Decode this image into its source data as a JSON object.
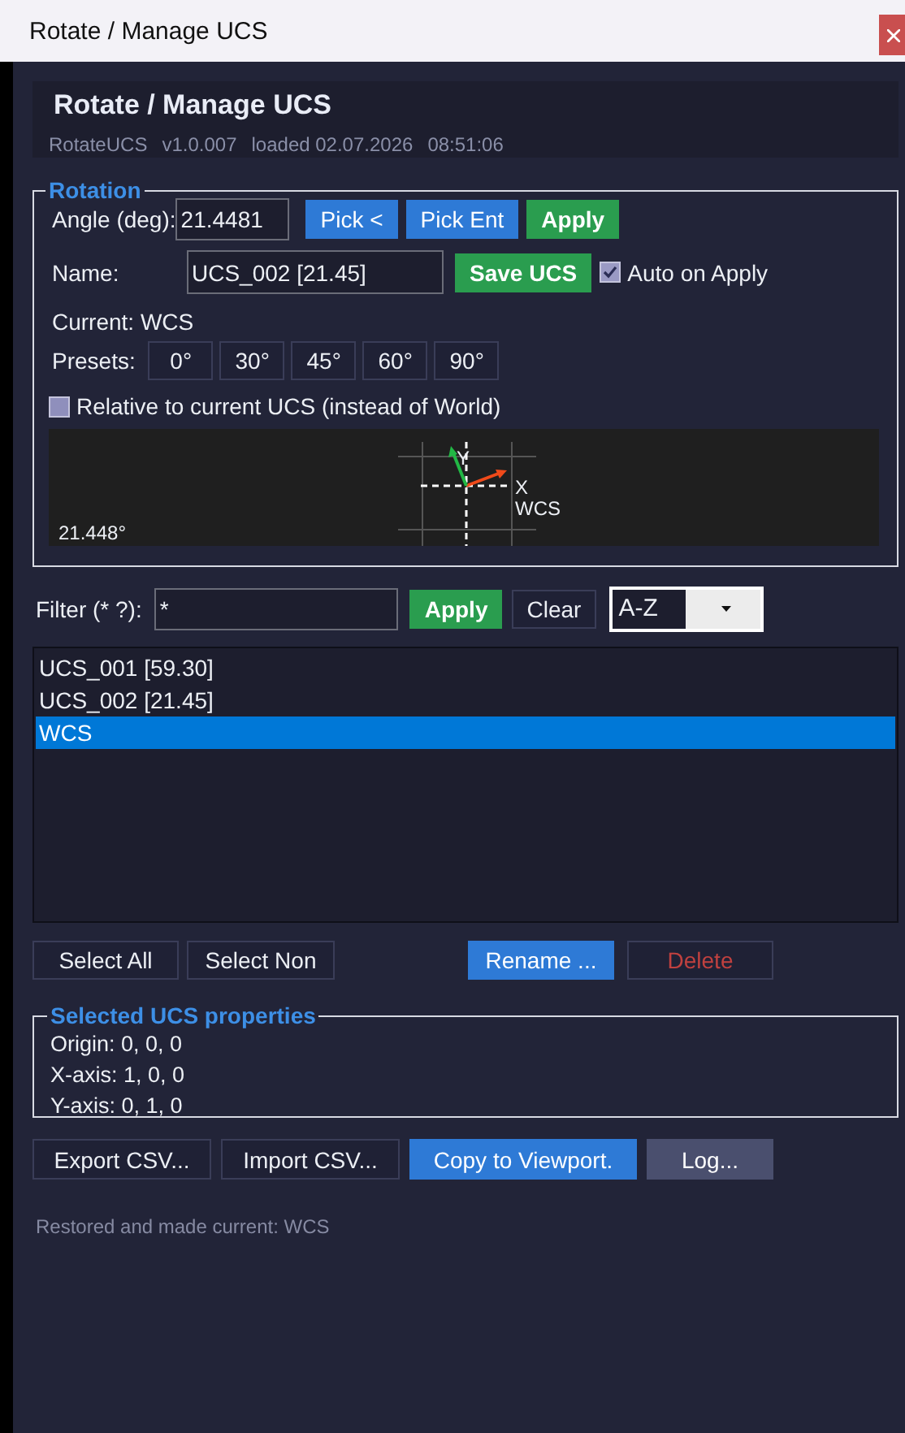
{
  "window": {
    "title": "Rotate / Manage UCS"
  },
  "header": {
    "title": "Rotate / Manage UCS",
    "meta": [
      "RotateUCS",
      "v1.0.007",
      "loaded 02.07.2026",
      "08:51:06"
    ]
  },
  "rotation": {
    "legend": "Rotation",
    "angle_label": "Angle (deg):",
    "angle_value": "21.4481",
    "angle_buttons": [
      {
        "label": "Pick <",
        "kind": "blue"
      },
      {
        "label": "Pick Ent",
        "kind": "blue"
      },
      {
        "label": "Apply",
        "kind": "green"
      }
    ],
    "name_label": "Name:",
    "name_value": "UCS_002 [21.45]",
    "save_button": {
      "label": "Save UCS",
      "kind": "green"
    },
    "auto_apply": {
      "label": "Auto on Apply",
      "checked": true
    },
    "current": "Current: WCS",
    "presets_label": "Presets:",
    "presets": [
      "0°",
      "30°",
      "45°",
      "60°",
      "90°"
    ],
    "relative": {
      "label": "Relative to current UCS (instead of World)",
      "checked": false
    },
    "preview": {
      "angle": "21.448°",
      "x_label": "X",
      "y_label": "Y",
      "ucs_label": "WCS"
    }
  },
  "filter": {
    "label": "Filter (* ?):",
    "value": "*",
    "buttons": [
      {
        "label": "Apply",
        "kind": "green"
      },
      {
        "label": "Clear",
        "kind": "plain"
      }
    ],
    "sort": "A-Z"
  },
  "ucs_list": [
    {
      "label": "UCS_001 [59.30]",
      "selected": false
    },
    {
      "label": "UCS_002 [21.45]",
      "selected": false
    },
    {
      "label": "WCS",
      "selected": true
    }
  ],
  "list_buttons": [
    {
      "label": "Select All",
      "kind": "plain"
    },
    {
      "label": "Select Non",
      "kind": "plain"
    },
    {
      "label": "Rename ...",
      "kind": "blue"
    },
    {
      "label": "Delete",
      "kind": "danger"
    }
  ],
  "properties": {
    "legend": "Selected UCS properties",
    "lines": [
      "Origin: 0, 0, 0",
      "X-axis: 1, 0, 0",
      "Y-axis: 0, 1, 0"
    ]
  },
  "bottom_buttons": [
    {
      "label": "Export CSV...",
      "kind": "plain"
    },
    {
      "label": "Import CSV...",
      "kind": "plain"
    },
    {
      "label": "Copy to Viewport.",
      "kind": "blue"
    },
    {
      "label": "Log...",
      "kind": "grey"
    }
  ],
  "status": "Restored and made current: WCS"
}
